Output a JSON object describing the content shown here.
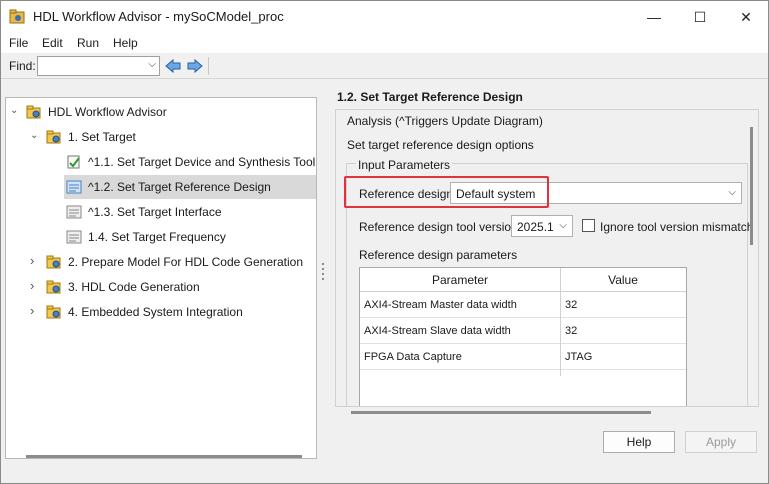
{
  "window": {
    "title": "HDL Workflow Advisor - mySoCModel_proc",
    "minimize_glyph": "—",
    "maximize_glyph": "☐",
    "close_glyph": "✕"
  },
  "menu": {
    "items": [
      "File",
      "Edit",
      "Run",
      "Help"
    ]
  },
  "find": {
    "label": "Find:",
    "value": "",
    "chevron": "⌵"
  },
  "tree": {
    "collapse_glyph": "⌄",
    "expand_glyph": "›",
    "items": [
      {
        "label": "HDL Workflow Advisor",
        "icon": "folder-gear-icon"
      },
      {
        "label": "1. Set Target",
        "icon": "folder-gear-icon"
      },
      {
        "label": "^1.1. Set Target Device and Synthesis Tool",
        "icon": "task-check-icon"
      },
      {
        "label": "^1.2. Set Target Reference Design",
        "icon": "task-icon"
      },
      {
        "label": "^1.3. Set Target Interface",
        "icon": "task-icon"
      },
      {
        "label": "1.4. Set Target Frequency",
        "icon": "task-icon"
      },
      {
        "label": "2. Prepare Model For HDL Code Generation",
        "icon": "folder-gear-icon"
      },
      {
        "label": "3. HDL Code Generation",
        "icon": "folder-gear-icon"
      },
      {
        "label": "4. Embedded System Integration",
        "icon": "folder-gear-icon"
      }
    ]
  },
  "right": {
    "title": "1.2. Set Target Reference Design",
    "analysis": "Analysis (^Triggers Update Diagram)",
    "description": "Set target reference design options",
    "group_title": "Input Parameters",
    "reference_design_label": "Reference design:",
    "reference_design_value": "Default system",
    "tool_version_label": "Reference design tool version:",
    "tool_version_value": "2025.1",
    "ignore_mismatch_label": "Ignore tool version mismatch",
    "params_label": "Reference design parameters",
    "table": {
      "headers": [
        "Parameter",
        "Value"
      ],
      "rows": [
        {
          "param": "AXI4-Stream Master data width",
          "value": "32"
        },
        {
          "param": "AXI4-Stream Slave data width",
          "value": "32"
        },
        {
          "param": "FPGA Data Capture",
          "value": "JTAG"
        }
      ]
    }
  },
  "buttons": {
    "help": "Help",
    "apply": "Apply"
  },
  "colors": {
    "highlight": "#e0343a",
    "selected_row": "#d9d9d9"
  }
}
